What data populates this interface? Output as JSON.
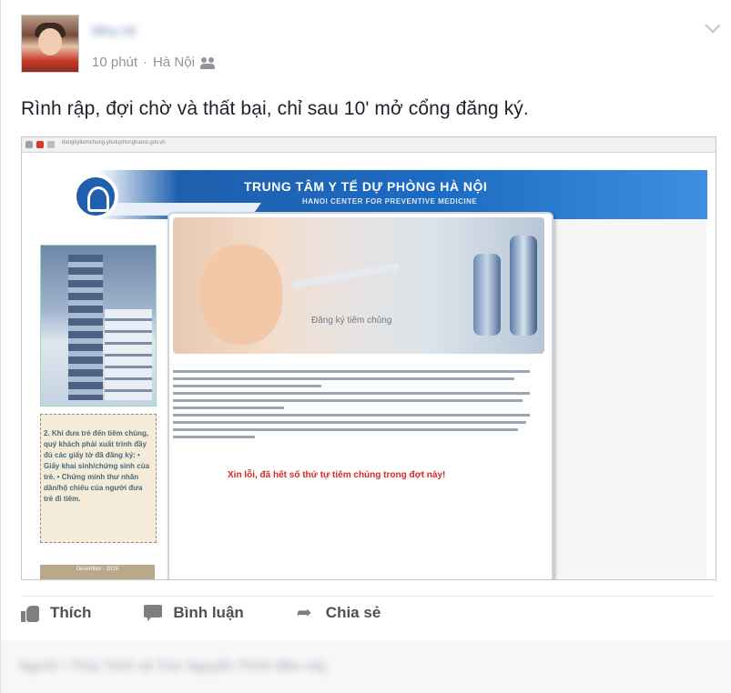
{
  "post": {
    "author": "Nhu Hi",
    "time": "10 phút",
    "separator": "·",
    "location": "Hà Nội",
    "audience_icon": "friends-icon",
    "text": "Rình rập, đợi chờ và thất bại, chỉ sau 10' mở cổng đăng ký."
  },
  "screenshot": {
    "url": "dangkytiemchung.yteduphonghanoi.gov.vn",
    "title": "TRUNG TÂM Y TẾ DỰ PHÒNG HÀ NỘI",
    "subtitle": "HANOI CENTER FOR PREVENTIVE MEDICINE",
    "hero_label": "Đăng ký tiêm chủng",
    "sidebar_text": "2. Khi đưa trẻ đến tiêm chủng, quý khách phải xuất trình đầy đủ các giấy tờ đã đăng ký: • Giấy khai sinh/chứng sinh của trẻ. • Chứng minh thư nhân dân/hộ chiếu của người đưa trẻ đi tiêm.",
    "sidebar_footer": "December - 2015",
    "error_message": "Xin lỗi, đã hết số thứ tự tiêm chủng trong đợt này!"
  },
  "actions": {
    "like": "Thích",
    "comment": "Bình luận",
    "share": "Chia sẻ"
  },
  "comment_preview": "Người • Thủy Trinh và Trúc Nguyễn Thích điều này"
}
